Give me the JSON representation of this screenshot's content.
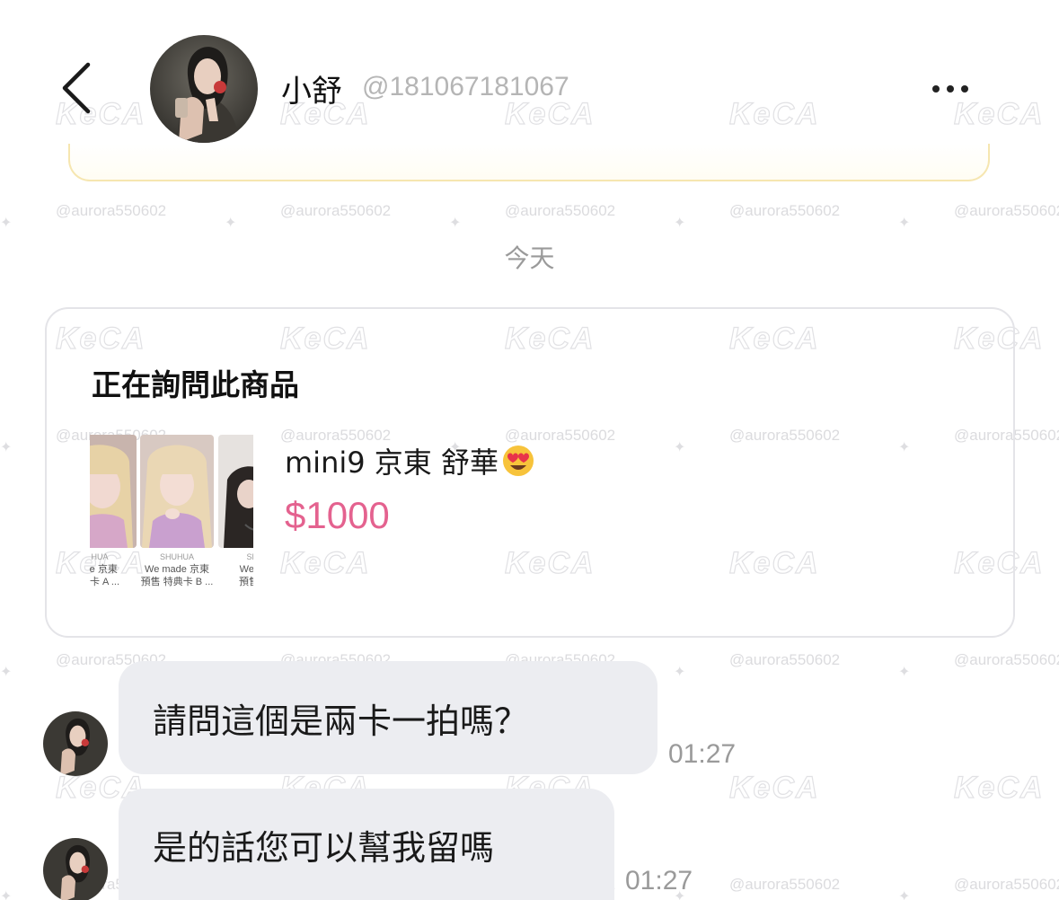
{
  "header": {
    "back_icon": "chevron-left-icon",
    "name": "小舒",
    "handle": "@181067181067",
    "more_icon": "more-horizontal-icon"
  },
  "date_separator": "今天",
  "product_card": {
    "title": "正在詢問此商品",
    "product_name": "mini9 京東 舒華",
    "emoji": "heart-eyes-emoji",
    "price": "$1000",
    "price_color": "#e4628f",
    "thumbnails": [
      {
        "tag": "HUA",
        "line1": "ide 京東",
        "line2": "典卡 A ..."
      },
      {
        "tag": "SHUHUA",
        "line1": "We made 京東",
        "line2": "預售 特典卡 B ..."
      },
      {
        "tag": "SHU",
        "line1": "We ma",
        "line2": "預售 特"
      }
    ]
  },
  "messages": [
    {
      "text": "請問這個是兩卡一拍嗎？",
      "time": "01:27"
    },
    {
      "text": "是的話您可以幫我留嗎",
      "time": "01:27"
    }
  ],
  "watermark": {
    "logo": "KeCA",
    "handle": "@aurora550602"
  },
  "colors": {
    "bubble_bg": "#ecedf1",
    "card_border": "#e4e4e8",
    "notice_border": "#f6e6b0"
  }
}
